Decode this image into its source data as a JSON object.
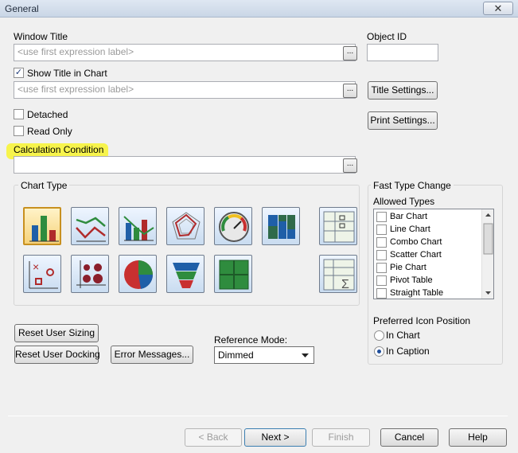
{
  "window": {
    "title": "General",
    "close_glyph": "✕"
  },
  "window_title": {
    "label": "Window Title",
    "placeholder": "<use first expression label>",
    "browse": "..."
  },
  "object_id": {
    "label": "Object ID",
    "value": ""
  },
  "show_title": {
    "label": "Show Title in Chart",
    "checked": true,
    "placeholder": "<use first expression label>",
    "browse": "..."
  },
  "buttons": {
    "title_settings": "Title Settings...",
    "print_settings": "Print Settings...",
    "reset_user_sizing": "Reset User Sizing",
    "reset_user_docking": "Reset User Docking",
    "error_messages": "Error Messages...",
    "back": "< Back",
    "next": "Next >",
    "finish": "Finish",
    "cancel": "Cancel",
    "help": "Help"
  },
  "detached": {
    "label": "Detached",
    "checked": false
  },
  "read_only": {
    "label": "Read Only",
    "checked": false
  },
  "calculation_condition": {
    "label": "Calculation Condition",
    "value": "",
    "browse": "...",
    "highlight_color": "#f7f43a"
  },
  "chart_type": {
    "label": "Chart Type",
    "icons": [
      "bar-chart-icon",
      "line-chart-icon",
      "combo-chart-icon",
      "radar-chart-icon",
      "gauge-chart-icon",
      "mekko-chart-icon",
      "pivot-table-icon",
      "scatter-chart-icon",
      "grid-chart-icon",
      "pie-chart-icon",
      "funnel-chart-icon",
      "block-chart-icon",
      "straight-table-icon"
    ],
    "selected": "bar-chart-icon"
  },
  "fast_type_change": {
    "label": "Fast Type Change",
    "allowed_types_label": "Allowed Types",
    "items": [
      {
        "label": "Bar Chart",
        "checked": false
      },
      {
        "label": "Line Chart",
        "checked": false
      },
      {
        "label": "Combo Chart",
        "checked": false
      },
      {
        "label": "Scatter Chart",
        "checked": false
      },
      {
        "label": "Pie Chart",
        "checked": false
      },
      {
        "label": "Pivot Table",
        "checked": false
      },
      {
        "label": "Straight Table",
        "checked": false
      }
    ],
    "preferred_icon_position_label": "Preferred Icon Position",
    "positions": [
      {
        "label": "In Chart",
        "selected": false
      },
      {
        "label": "In Caption",
        "selected": true
      }
    ]
  },
  "reference_mode": {
    "label": "Reference Mode:",
    "value": "Dimmed"
  }
}
